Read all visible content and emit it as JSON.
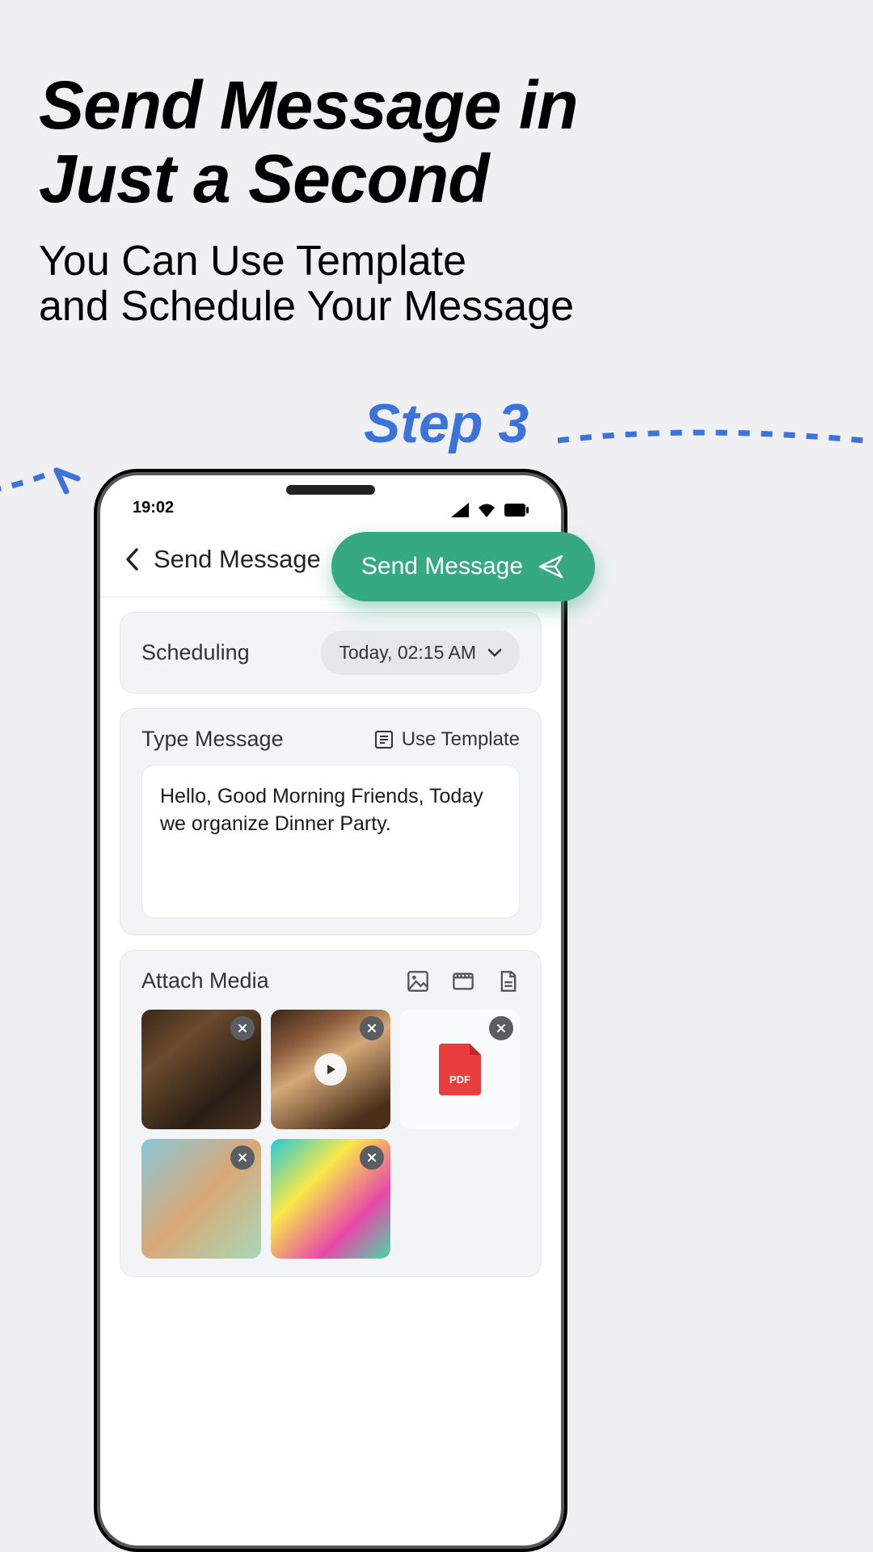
{
  "promo": {
    "title_l1": "Send Message in",
    "title_l2": "Just a Second",
    "subtitle_l1": "You Can Use Template",
    "subtitle_l2": "and Schedule Your Message",
    "step": "Step 3"
  },
  "status_bar": {
    "time": "19:02"
  },
  "header": {
    "title": "Send Message"
  },
  "send_button": {
    "label": "Send Message"
  },
  "scheduling": {
    "label": "Scheduling",
    "value": "Today, 02:15 AM"
  },
  "compose": {
    "label": "Type Message",
    "use_template": "Use Template",
    "text": "Hello, Good Morning Friends, Today we organize Dinner Party."
  },
  "attach": {
    "label": "Attach Media",
    "pdf_badge": "PDF",
    "items": [
      {
        "type": "image"
      },
      {
        "type": "video"
      },
      {
        "type": "pdf"
      },
      {
        "type": "image"
      },
      {
        "type": "image"
      }
    ]
  }
}
